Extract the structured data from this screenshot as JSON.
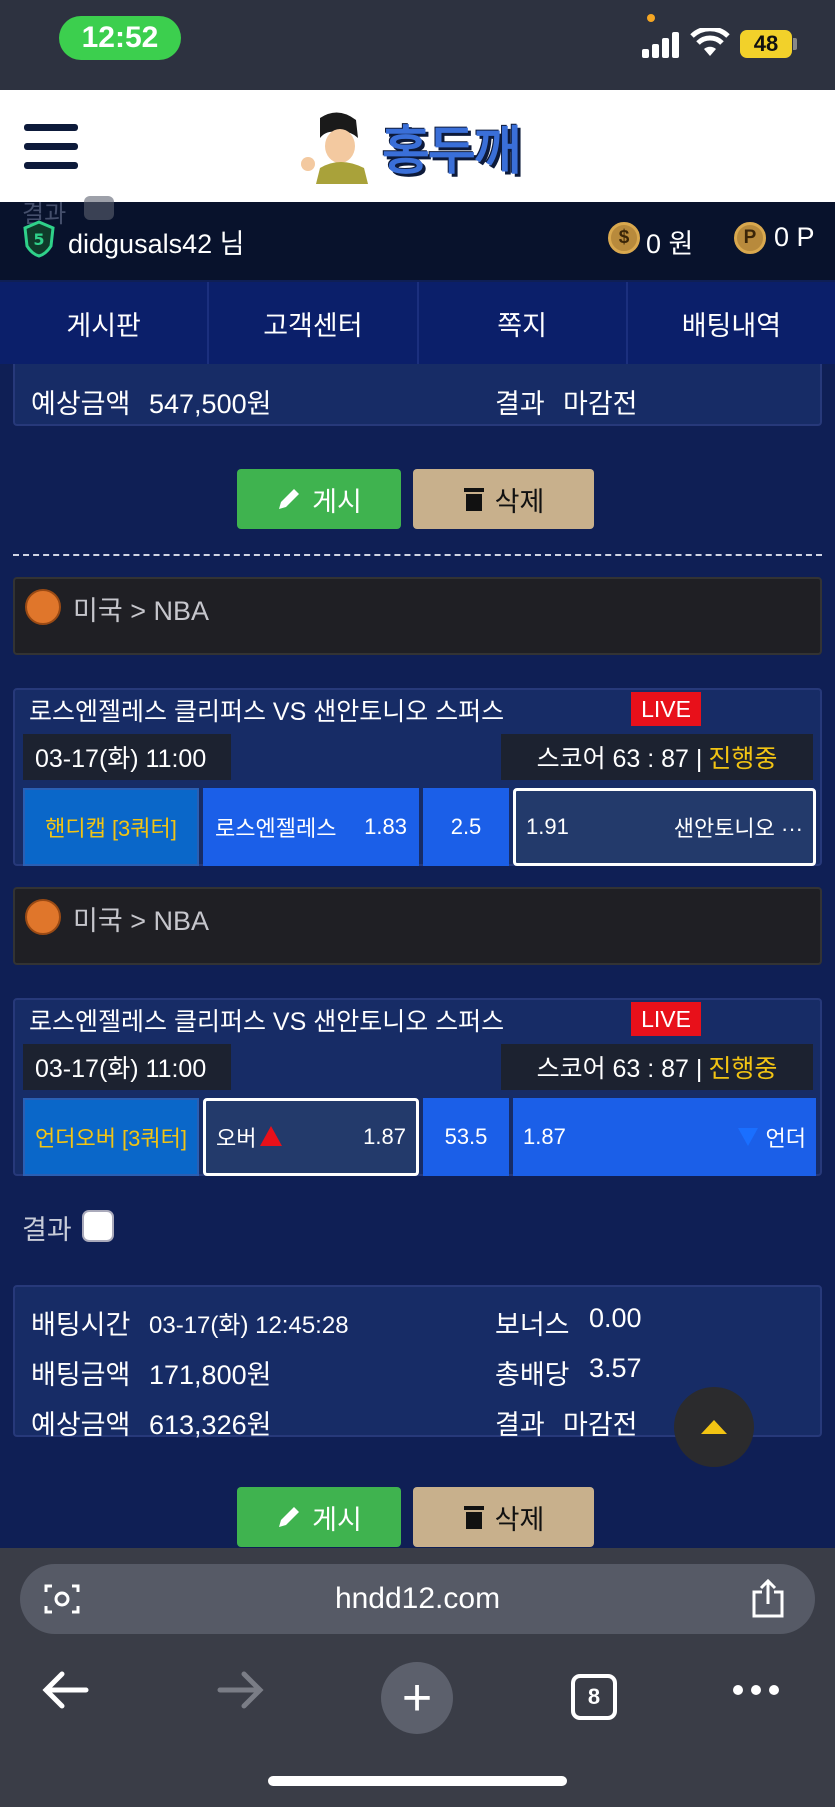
{
  "status_bar": {
    "time": "12:52",
    "battery": "48"
  },
  "header": {
    "logo_text": "홍두깨"
  },
  "user": {
    "username": "didgusals42 님",
    "money_icon": "$",
    "money": "0 원",
    "point_icon": "P",
    "points": "0 P",
    "ghost_result": "결과"
  },
  "nav": {
    "tabs": [
      "게시판",
      "고객센터",
      "쪽지",
      "배팅내역"
    ]
  },
  "bet1": {
    "expected_label": "예상금액",
    "expected_value": "547,500원",
    "result_label": "결과",
    "result_value": "마감전",
    "post_label": "게시",
    "delete_label": "삭제"
  },
  "matches": [
    {
      "league": "미국",
      "league_sep": ">",
      "league_name": "NBA",
      "title": "로스엔젤레스 클리퍼스 VS 샌안토니오 스퍼스",
      "live": "LIVE",
      "date": "03-17(화) 11:00",
      "score": "스코어 63 : 87 |",
      "status": "진행중",
      "bet_type": "핸디캡 [3쿼터]",
      "home_name": "로스엔젤레스",
      "home_odds": "1.83",
      "line": "2.5",
      "away_odds": "1.91",
      "away_name": "샌안토니오 ···"
    },
    {
      "league": "미국",
      "league_sep": ">",
      "league_name": "NBA",
      "title": "로스엔젤레스 클리퍼스 VS 샌안토니오 스퍼스",
      "live": "LIVE",
      "date": "03-17(화) 11:00",
      "score": "스코어 63 : 87 |",
      "status": "진행중",
      "bet_type": "언더오버 [3쿼터]",
      "home_name": "오버",
      "home_odds": "1.87",
      "line": "53.5",
      "away_odds": "1.87",
      "away_name": "언더"
    }
  ],
  "result_row": {
    "label": "결과"
  },
  "bet2": {
    "time_label": "배팅시간",
    "time_value": "03-17(화) 12:45:28",
    "bonus_label": "보너스",
    "bonus_value": "0.00",
    "amount_label": "배팅금액",
    "amount_value": "171,800원",
    "odds_label": "총배당",
    "odds_value": "3.57",
    "expected_label": "예상금액",
    "expected_value": "613,326원",
    "result_label": "결과",
    "result_value": "마감전",
    "post_label": "게시",
    "delete_label": "삭제"
  },
  "browser": {
    "url": "hndd12.com",
    "tab_count": "8"
  }
}
